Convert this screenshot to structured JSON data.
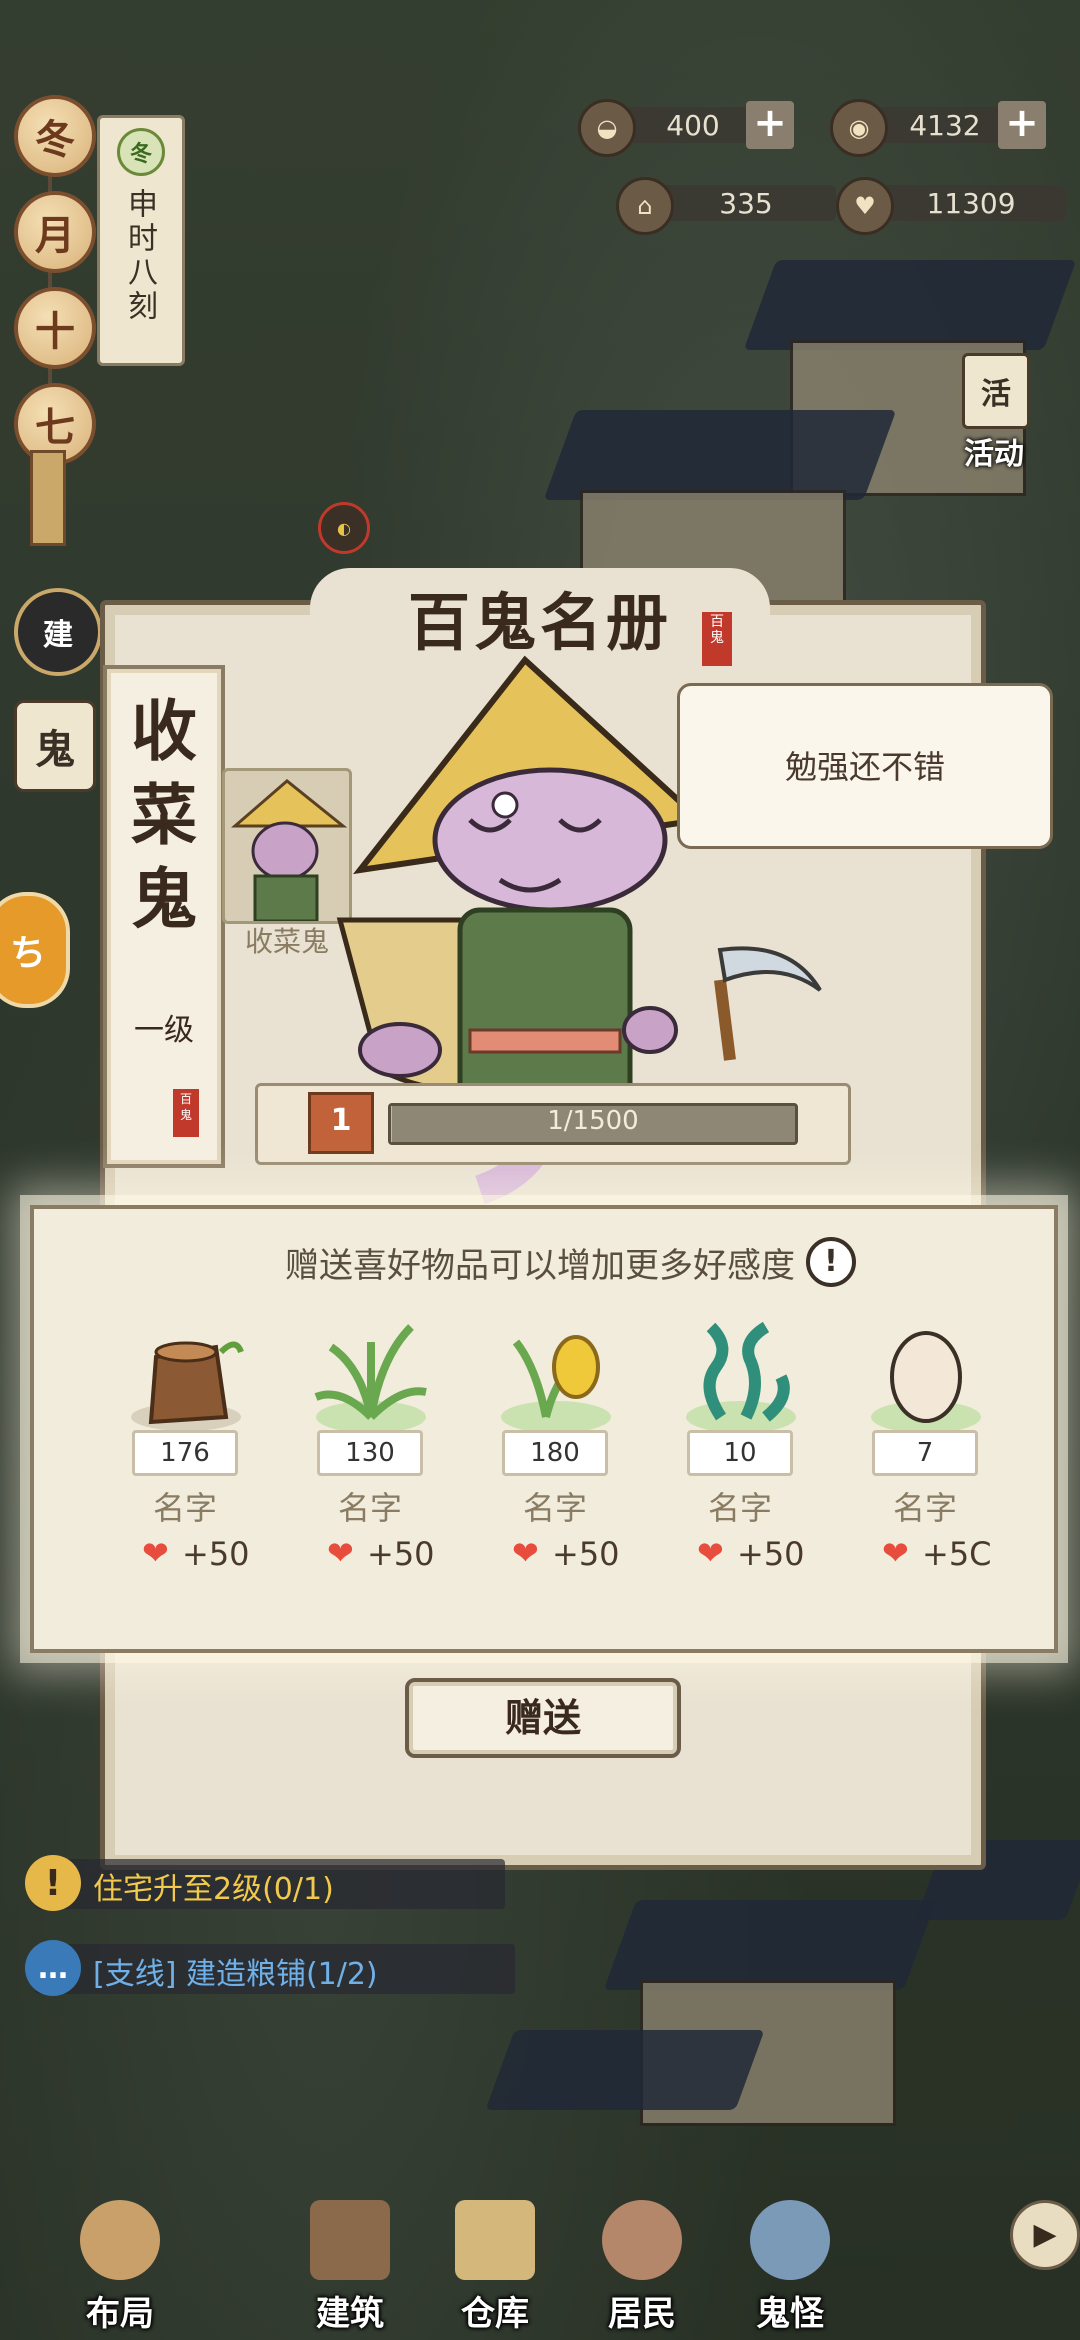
{
  "calendar": {
    "beads": [
      "冬",
      "月",
      "十",
      "七"
    ],
    "season_badge": "冬",
    "time_text": "申时八刻"
  },
  "resources": {
    "silver": "400",
    "coins": "4132",
    "houses": "335",
    "hearts": "11309"
  },
  "activity": {
    "label": "活动",
    "icon_char": "活"
  },
  "side": {
    "build_label": "建"
  },
  "panel": {
    "title": "百鬼名册",
    "seal_text": "百鬼",
    "name": "收菜鬼",
    "rank": "一级",
    "portrait_label": "收菜鬼",
    "speech": "勉强还不错",
    "level": "1",
    "xp_text": "1/1500",
    "xp_progress": 0.0007
  },
  "gift": {
    "hint": "赠送喜好物品可以增加更多好感度",
    "hint_icon": "!",
    "items": [
      {
        "count": "176",
        "name": "名字",
        "bonus": "+50",
        "art": "log"
      },
      {
        "count": "130",
        "name": "名字",
        "bonus": "+50",
        "art": "grass"
      },
      {
        "count": "180",
        "name": "名字",
        "bonus": "+50",
        "art": "corn"
      },
      {
        "count": "10",
        "name": "名字",
        "bonus": "+50",
        "art": "seaweed"
      },
      {
        "count": "7",
        "name": "名字",
        "bonus": "+5C",
        "art": "egg"
      }
    ],
    "send_label": "赠送"
  },
  "quests": [
    {
      "text": "住宅升至2级(0/1)",
      "icon": "!"
    },
    {
      "text": "[支线] 建造粮铺(1/2)",
      "icon": "…"
    }
  ],
  "nav": {
    "items": [
      "布局",
      "建筑",
      "仓库",
      "居民",
      "鬼怪"
    ],
    "arrow": "▶"
  }
}
